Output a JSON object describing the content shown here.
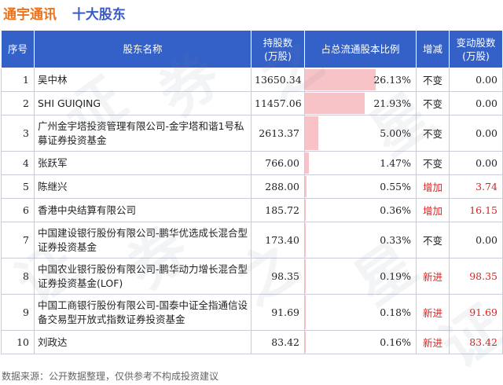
{
  "header": {
    "subject": "通宇通讯",
    "report": "十大股东"
  },
  "table": {
    "columns": [
      "序号",
      "股东名称",
      "持股数\n(万股)",
      "占总流通股本比例",
      "增减",
      "变动股数\n(万股)"
    ],
    "rows": [
      {
        "idx": "1",
        "name": "吴中林",
        "shares": "13650.34",
        "ratio_text": "26.13%",
        "ratio": 26.13,
        "change": "不变",
        "delta": "0.00",
        "tall": false
      },
      {
        "idx": "2",
        "name": "SHI GUIQING",
        "shares": "11457.06",
        "ratio_text": "21.93%",
        "ratio": 21.93,
        "change": "不变",
        "delta": "0.00",
        "tall": false
      },
      {
        "idx": "3",
        "name": "广州金宇塔投资管理有限公司-金宇塔和谐1号私募证券投资基金",
        "shares": "2613.37",
        "ratio_text": "5.00%",
        "ratio": 5.0,
        "change": "不变",
        "delta": "0.00",
        "tall": true
      },
      {
        "idx": "4",
        "name": "张跃军",
        "shares": "766.00",
        "ratio_text": "1.47%",
        "ratio": 1.47,
        "change": "不变",
        "delta": "0.00",
        "tall": false
      },
      {
        "idx": "5",
        "name": "陈继兴",
        "shares": "288.00",
        "ratio_text": "0.55%",
        "ratio": 0.55,
        "change": "增加",
        "delta": "3.74",
        "tall": false
      },
      {
        "idx": "6",
        "name": "香港中央结算有限公司",
        "shares": "185.72",
        "ratio_text": "0.36%",
        "ratio": 0.36,
        "change": "增加",
        "delta": "16.15",
        "tall": false
      },
      {
        "idx": "7",
        "name": "中国建设银行股份有限公司-鹏华优选成长混合型证券投资基金",
        "shares": "173.40",
        "ratio_text": "0.33%",
        "ratio": 0.33,
        "change": "不变",
        "delta": "0.00",
        "tall": true
      },
      {
        "idx": "8",
        "name": "中国农业银行股份有限公司-鹏华动力增长混合型证券投资基金(LOF)",
        "shares": "98.35",
        "ratio_text": "0.19%",
        "ratio": 0.19,
        "change": "新进",
        "delta": "98.35",
        "tall": true
      },
      {
        "idx": "9",
        "name": "中国工商银行股份有限公司-国泰中证全指通信设备交易型开放式指数证券投资基金",
        "shares": "91.69",
        "ratio_text": "0.18%",
        "ratio": 0.18,
        "change": "新进",
        "delta": "91.69",
        "tall": true
      },
      {
        "idx": "10",
        "name": "刘政达",
        "shares": "83.42",
        "ratio_text": "0.16%",
        "ratio": 0.16,
        "change": "新进",
        "delta": "83.42",
        "tall": false
      }
    ]
  },
  "footer": {
    "source": "数据来源：公开数据整理，仅供参考不构成投资建议"
  },
  "colors": {
    "header_bg": "#3461c7",
    "bar": "#f7c3c6",
    "up": "#e02020",
    "title_orange": "#e8731c",
    "title_blue": "#3a5bc7"
  }
}
